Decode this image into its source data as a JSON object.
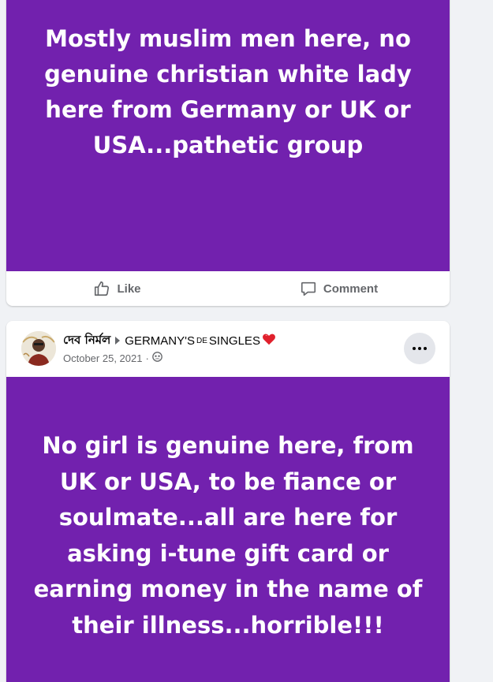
{
  "colors": {
    "post_background": "#7221ae",
    "post_text": "#ffffff",
    "action_text": "#65676b",
    "page_background": "#f0f2f5"
  },
  "post1": {
    "text": "Mostly muslim men here, no genuine christian white lady here from Germany or UK or USA...pathetic group",
    "actions": {
      "like_label": "Like",
      "comment_label": "Comment"
    }
  },
  "post2": {
    "author": "দেব নির্মল",
    "group_name_part1": "GERMANY'S",
    "group_name_part2": "DE",
    "group_name_part3": "SINGLES",
    "group_emoji": "heart-icon",
    "date": "October 25, 2021",
    "separator": "·",
    "privacy_icon": "group-members-icon",
    "text": "No girl is genuine here, from UK or USA, to be fiance or soulmate...all are here for asking i-tune gift card or earning money in the name of their illness...horrible!!!"
  }
}
